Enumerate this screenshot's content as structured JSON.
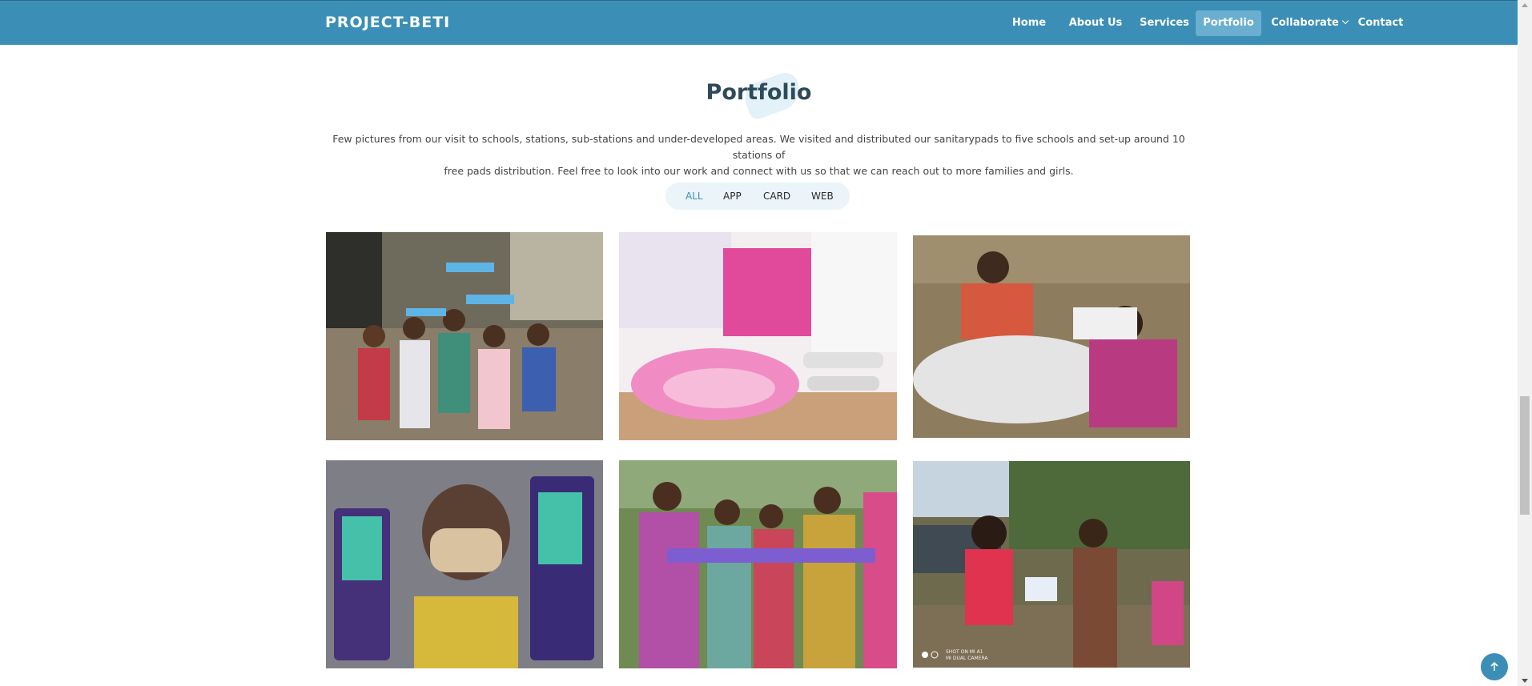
{
  "brand": {
    "logo": "PROJECT-BETI"
  },
  "nav": {
    "home": "Home",
    "about": "About Us",
    "services": "Services",
    "portfolio": "Portfolio",
    "collaborate": "Collaborate",
    "contact": "Contact"
  },
  "portfolio": {
    "title": "Portfolio",
    "description_line1": "Few pictures from our visit to schools, stations, sub-stations and under-developed areas. We visited and distributed our sanitarypads to five schools and set-up around 10 stations of",
    "description_line2": "free pads distribution. Feel free to look into our work and connect with us so that we can reach out to more families and girls.",
    "filters": [
      "ALL",
      "APP",
      "CARD",
      "WEB"
    ],
    "active_filter": "ALL"
  },
  "images": [
    {
      "icon": "photo-girls-with-pads"
    },
    {
      "icon": "photo-pink-pads-stack"
    },
    {
      "icon": "photo-women-packing-pads"
    },
    {
      "icon": "photo-girl-with-mask-holding-pads"
    },
    {
      "icon": "photo-women-group-holding-pads"
    },
    {
      "icon": "photo-volunteer-distributing-pads"
    }
  ],
  "photo_caption": {
    "line1": "SHOT ON MI A1",
    "line2": "MI DUAL CAMERA"
  },
  "colors": {
    "header": "#3b8fb6",
    "accent": "#3b8fb6",
    "title": "#2f4a58"
  }
}
